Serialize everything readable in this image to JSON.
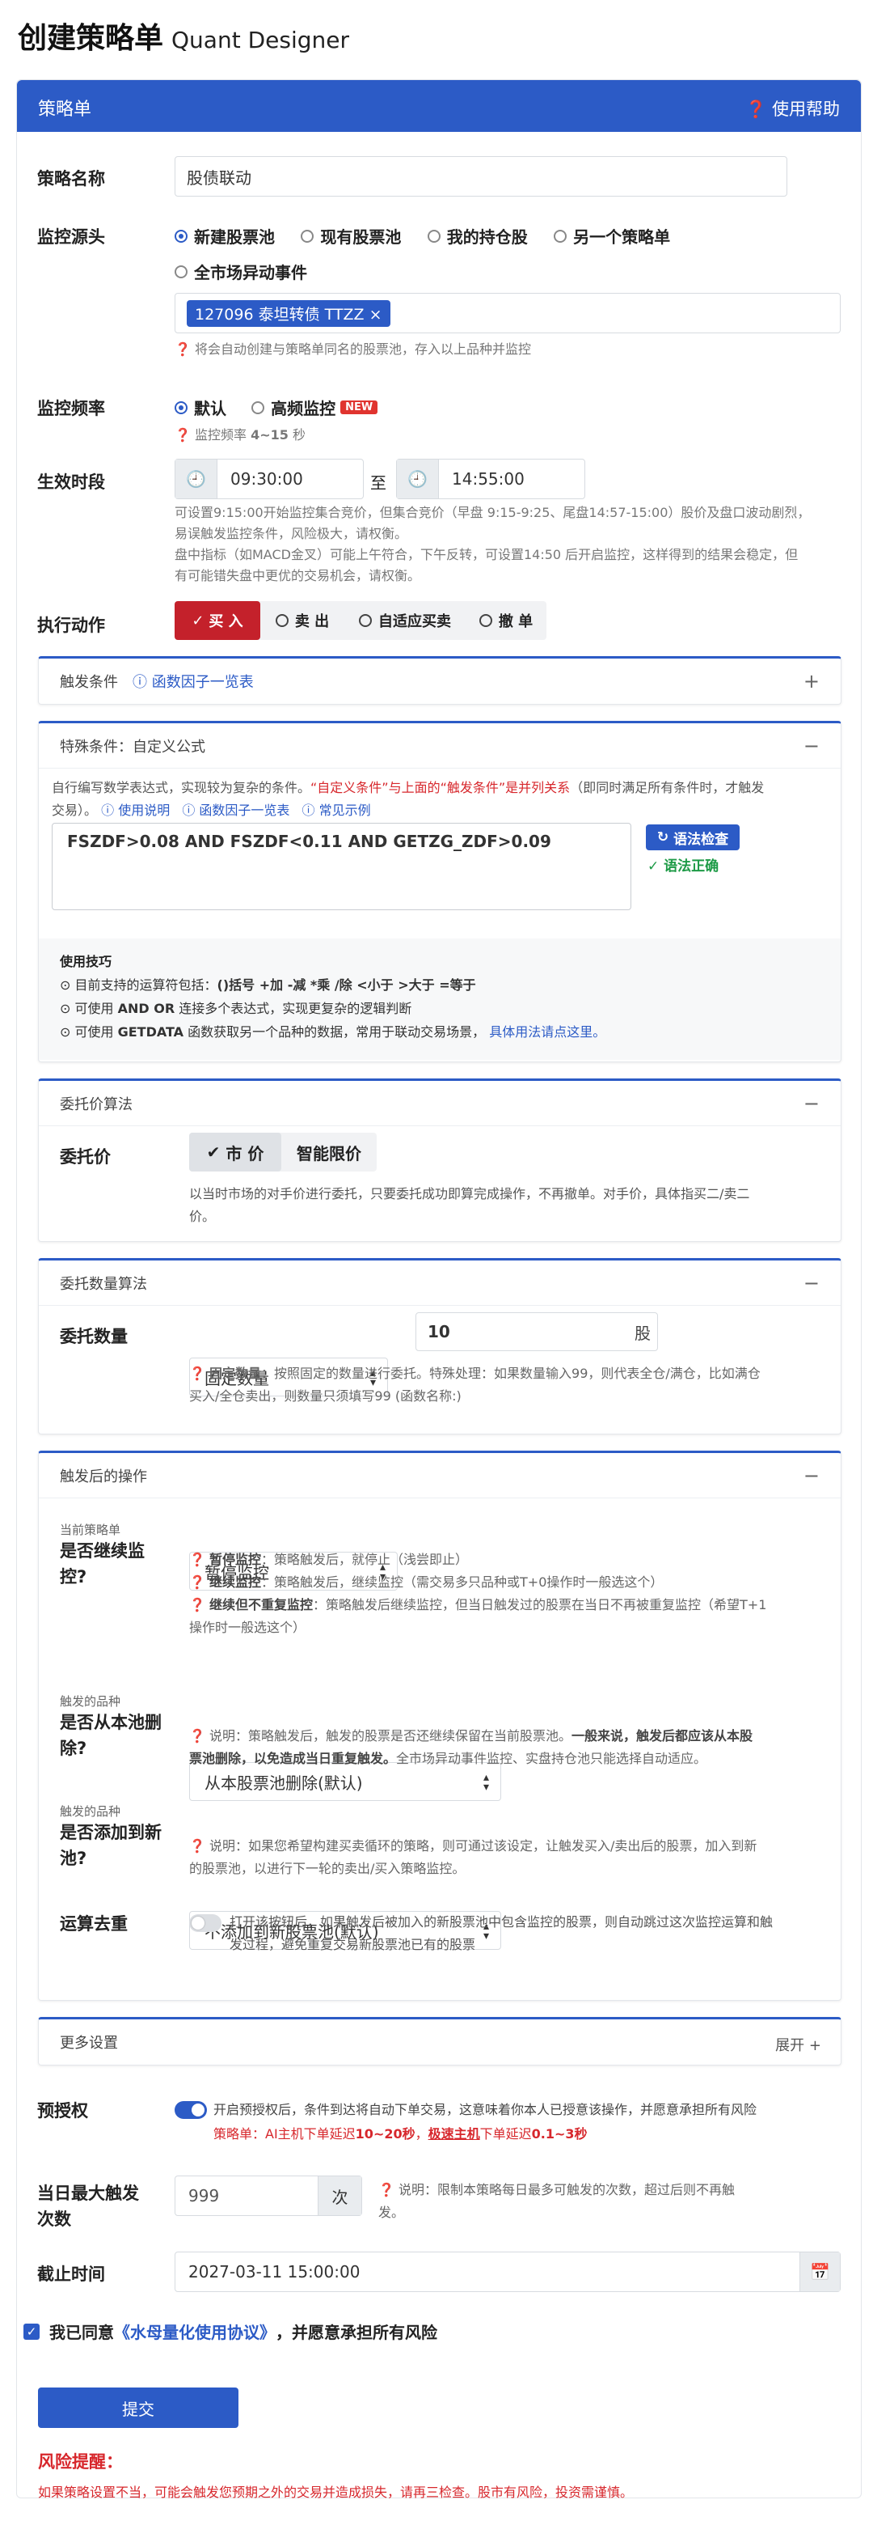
{
  "page": {
    "title": "创建策略单",
    "subtitle": "Quant Designer"
  },
  "card": {
    "title": "策略单",
    "help": "使用帮助"
  },
  "name": {
    "label": "策略名称",
    "value": "股债联动"
  },
  "source": {
    "label": "监控源头",
    "options": [
      "新建股票池",
      "现有股票池",
      "我的持仓股",
      "另一个策略单",
      "全市场异动事件"
    ],
    "tag": "127096 泰坦转债 TTZZ",
    "hint": "将会自动创建与策略单同名的股票池，存入以上品种并监控"
  },
  "freq": {
    "label": "监控频率",
    "opt1": "默认",
    "opt2": "高频监控",
    "badge": "NEW",
    "hint": "监控频率",
    "hint_val": "4~15",
    "hint_unit": "秒"
  },
  "time": {
    "label": "生效时段",
    "start": "09:30:00",
    "sep": "至",
    "end": "14:55:00",
    "note1": "可设置9:15:00开始监控集合竞价，但集合竞价（早盘 9:15-9:25、尾盘14:57-15:00）股价及盘口波动剧烈，",
    "note2": "易误触发监控条件，风险极大，请权衡。",
    "note3": "盘中指标（如MACD金叉）可能上午符合，下午反转，可设置14:50 后开启监控，这样得到的结果会稳定，但",
    "note4": "有可能错失盘中更优的交易机会，请权衡。"
  },
  "action": {
    "label": "执行动作",
    "buy": "买 入",
    "sell": "卖 出",
    "auto": "自适应买卖",
    "cancel": "撤 单"
  },
  "trigger": {
    "title": "触发条件",
    "link": "函数因子一览表"
  },
  "special": {
    "title": "特殊条件：自定义公式",
    "desc1": "自行编写数学表达式，实现较为复杂的条件。",
    "desc_red": "“自定义条件”与上面的“触发条件”是并列关系",
    "desc2": "（即同时满足所有条件时，才触发",
    "desc3": "交易）。",
    "link1": "使用说明",
    "link2": "函数因子一览表",
    "link3": "常见示例",
    "formula": "FSZDF>0.08 AND FSZDF<0.11 AND GETZG_ZDF>0.09",
    "check_btn": "语法检查",
    "check_ok": "语法正确",
    "tips_title": "使用技巧",
    "tip1a": "目前支持的运算符包括：",
    "tip1b": "()括号 +加 -减 *乘 /除 <小于 >大于 =等于",
    "tip2a": "可使用",
    "tip2b": "AND OR",
    "tip2c": "连接多个表达式，实现更复杂的逻辑判断",
    "tip3a": "可使用",
    "tip3b": "GETDATA",
    "tip3c": "函数获取另一个品种的数据，常用于联动交易场景，",
    "tip3d": "具体用法请点这里。"
  },
  "price": {
    "title": "委托价算法",
    "label": "委托价",
    "opt1": "市 价",
    "opt2": "智能限价",
    "note1": "以当时市场的对手价进行委托，只要委托成功即算完成操作，不再撤单。对手价，具体指买二/卖二",
    "note2": "价。"
  },
  "qty": {
    "title": "委托数量算法",
    "label": "委托数量",
    "mode": "固定数量",
    "value": "10",
    "unit": "股",
    "note_b": "固定数量",
    "note1": "：按照固定的数量进行委托。特殊处理：如果数量输入99，则代表全仓/满仓，比如满仓",
    "note2": "买入/全仓卖出，则数量只须填写99 (函数名称:)"
  },
  "after": {
    "title": "触发后的操作",
    "cont_small": "当前策略单",
    "cont_label1": "是否继续监",
    "cont_label2": "控?",
    "cont_value": "暂停监控",
    "c1b": "暂停监控",
    "c1": "：策略触发后，就停止（浅尝即止）",
    "c2b": "继续监控",
    "c2": "：策略触发后，继续监控（需交易多只品种或T+0操作时一般选这个）",
    "c3b": "继续但不重复监控",
    "c3": "：策略触发后继续监控，但当日触发过的股票在当日不再被重复监控（希望T+1",
    "c3x": "操作时一般选这个）",
    "rm_small": "触发的品种",
    "rm_label1": "是否从本池删",
    "rm_label2": "除?",
    "rm_value": "从本股票池删除(默认)",
    "rm1": "说明：策略触发后，触发的股票是否还继续保留在当前股票池。",
    "rm1b": "一般来说，触发后都应该从本股",
    "rm2b": "票池删除，以免造成当日重复触发。",
    "rm2": "全市场异动事件监控、实盘持仓池只能选择自动适应。",
    "add_small": "触发的品种",
    "add_label1": "是否添加到新",
    "add_label2": "池?",
    "add_value": "不添加到新股票池(默认)",
    "add1": "说明：如果您希望构建买卖循环的策略，则可通过该设定，让触发买入/卖出后的股票，加入到新",
    "add2": "的股票池，以进行下一轮的卖出/买入策略监控。",
    "dedup_label": "运算去重",
    "dedup1": "打开该按钮后，如果触发后被加入的新股票池中包含监控的股票，则自动跳过这次监控运算和触",
    "dedup2": "发过程，避免重复交易新股票池已有的股票"
  },
  "more": {
    "title": "更多设置",
    "expand": "展开"
  },
  "preauth": {
    "label": "预授权",
    "text": "开启预授权后，条件到达将自动下单交易，这意味着你本人已授意该操作，并愿意承担所有风险",
    "line2a": "策略单：AI主机下单延迟",
    "line2b": "10~20秒",
    "line2c": "，",
    "line2d": "极速主机",
    "line2e": "下单延迟",
    "line2f": "0.1~3秒"
  },
  "maxday": {
    "label1": "当日最大触发",
    "label2": "次数",
    "value": "999",
    "unit": "次",
    "note1": "说明：限制本策略每日最多可触发的次数，超过后则不再触",
    "note2": "发。"
  },
  "deadline": {
    "label": "截止时间",
    "value": "2027-03-11 15:00:00"
  },
  "agree": {
    "a": "我已同意",
    "b": "《水母量化使用协议》",
    "c": "，并愿意承担所有风险"
  },
  "submit": "提交",
  "risk": {
    "title": "风险提醒：",
    "text": "如果策略设置不当，可能会触发您预期之外的交易并造成损失，请再三检查。股市有风险，投资需谨慎。"
  }
}
